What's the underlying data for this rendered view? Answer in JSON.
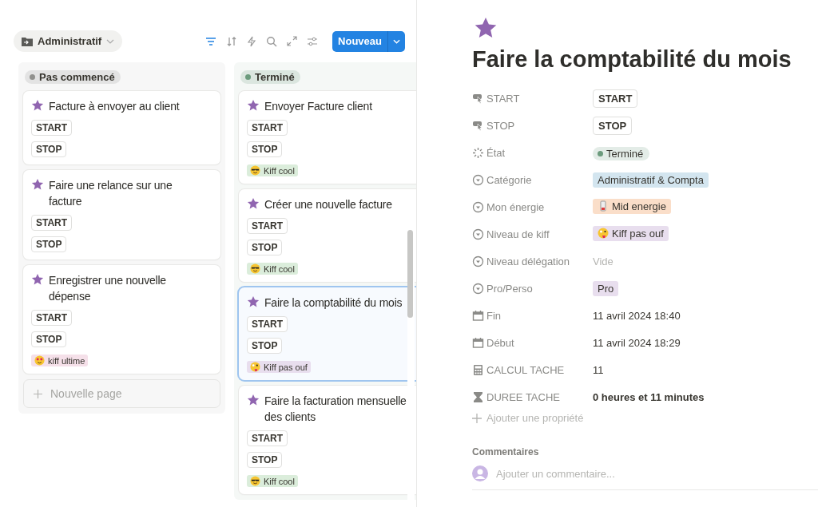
{
  "toolbar": {
    "view": "Administratif",
    "new_button": "Nouveau"
  },
  "columns": [
    {
      "status": "Pas commencé",
      "color": "#91918e",
      "add_label": "Nouvelle page",
      "cards": [
        {
          "title": "Facture à envoyer au client",
          "buttons": [
            "START",
            "STOP"
          ],
          "selected": false
        },
        {
          "title": "Faire une relance sur une facture",
          "buttons": [
            "START",
            "STOP"
          ],
          "selected": false
        },
        {
          "title": "Enregistrer une nouvelle dépense",
          "buttons": [
            "START",
            "STOP"
          ],
          "selected": false,
          "tag": {
            "kind": "ultime",
            "label": "kiff ultime",
            "color": "#f5e0e9"
          }
        }
      ]
    },
    {
      "status": "Terminé",
      "color": "#6c9b7d",
      "cards": [
        {
          "title": "Envoyer Facture client",
          "buttons": [
            "START",
            "STOP"
          ],
          "selected": false,
          "tag": {
            "kind": "cool",
            "label": "Kiff cool",
            "color": "#dbeddb"
          }
        },
        {
          "title": "Créer une nouvelle facture",
          "buttons": [
            "START",
            "STOP"
          ],
          "selected": false,
          "tag": {
            "kind": "cool",
            "label": "Kiff cool",
            "color": "#dbeddb"
          }
        },
        {
          "title": "Faire la comptabilité du mois",
          "buttons": [
            "START",
            "STOP"
          ],
          "selected": true,
          "tag": {
            "kind": "pas_ouf",
            "label": "Kiff pas ouf",
            "color": "#e8deee"
          }
        },
        {
          "title": "Faire la facturation mensuelle des clients",
          "buttons": [
            "START",
            "STOP"
          ],
          "selected": false,
          "tag": {
            "kind": "cool",
            "label": "Kiff cool",
            "color": "#dbeddb"
          }
        }
      ]
    }
  ],
  "page": {
    "title": "Faire la comptabilité du mois",
    "properties": [
      {
        "kind": "button",
        "label": "START",
        "value": "START"
      },
      {
        "kind": "button",
        "label": "STOP",
        "value": "STOP"
      },
      {
        "kind": "status",
        "label": "État",
        "tag": {
          "label": "Terminé",
          "color": "#6c9b7d"
        }
      },
      {
        "kind": "select",
        "label": "Catégorie",
        "tag": {
          "label": "Administratif & Compta",
          "color": "#d3e5ef"
        }
      },
      {
        "kind": "select",
        "label": "Mon énergie",
        "tag": {
          "kind": "energie",
          "label": "Mid energie",
          "color": "#fadec9"
        }
      },
      {
        "kind": "select",
        "label": "Niveau de kiff",
        "tag": {
          "kind": "pas_ouf",
          "label": "Kiff pas ouf",
          "color": "#e8deee"
        }
      },
      {
        "kind": "select",
        "label": "Niveau délégation",
        "placeholder": "Vide"
      },
      {
        "kind": "select",
        "label": "Pro/Perso",
        "tag": {
          "label": "Pro",
          "color": "#e8deee"
        }
      },
      {
        "kind": "date",
        "label": "Fin",
        "value": "11 avril 2024 18:40"
      },
      {
        "kind": "date",
        "label": "Début",
        "value": "11 avril 2024 18:29"
      },
      {
        "kind": "number",
        "label": "CALCUL TACHE",
        "value": "11"
      },
      {
        "kind": "duration",
        "label": "DUREE TACHE",
        "value": "0 heures et 11 minutes"
      }
    ],
    "add_property": "Ajouter une propriété",
    "comments": {
      "heading": "Commentaires",
      "placeholder": "Ajouter un commentaire..."
    }
  }
}
